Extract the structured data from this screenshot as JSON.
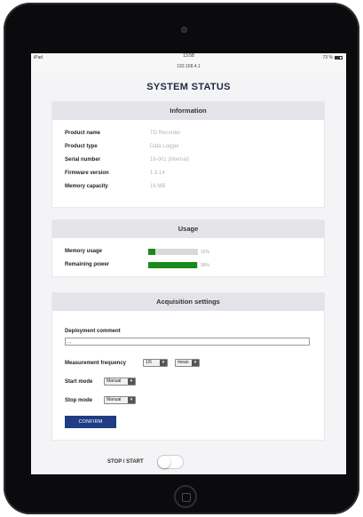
{
  "status_bar": {
    "device": "iPad",
    "time": "13:58",
    "battery": "73 %"
  },
  "url_bar": {
    "text": "192.168.4.1"
  },
  "page": {
    "title": "SYSTEM STATUS"
  },
  "information": {
    "header": "Information",
    "rows": [
      {
        "label": "Product name",
        "value": "TD Recorder"
      },
      {
        "label": "Product type",
        "value": "Data Logger"
      },
      {
        "label": "Serial number",
        "value": "16-001 (internal)"
      },
      {
        "label": "Firmware version",
        "value": "1.3.14"
      },
      {
        "label": "Memory capacity",
        "value": "16 MB"
      }
    ]
  },
  "usage": {
    "header": "Usage",
    "memory": {
      "label": "Memory usage",
      "percent": 15,
      "percent_text": "15%"
    },
    "power": {
      "label": "Remaining power",
      "percent": 98,
      "percent_text": "98%"
    },
    "bar_color": "#1a8a1a"
  },
  "acquisition": {
    "header": "Acquisition settings",
    "deployment_comment": {
      "label": "Deployment comment",
      "value": "..."
    },
    "measurement_frequency": {
      "label": "Measurement frequency",
      "value_select": "1/5",
      "unit_select": "mean"
    },
    "start_mode": {
      "label": "Start mode",
      "value": "Manual"
    },
    "stop_mode": {
      "label": "Stop mode",
      "value": "Manual"
    },
    "confirm_label": "CONFIRM",
    "confirm_color": "#1f3c84"
  },
  "stop_start": {
    "label": "STOP / START",
    "enabled": false
  },
  "icons": {
    "select_arrow": "chevron-down-icon",
    "battery": "battery-icon",
    "home": "home-button-icon",
    "camera": "camera-icon"
  }
}
